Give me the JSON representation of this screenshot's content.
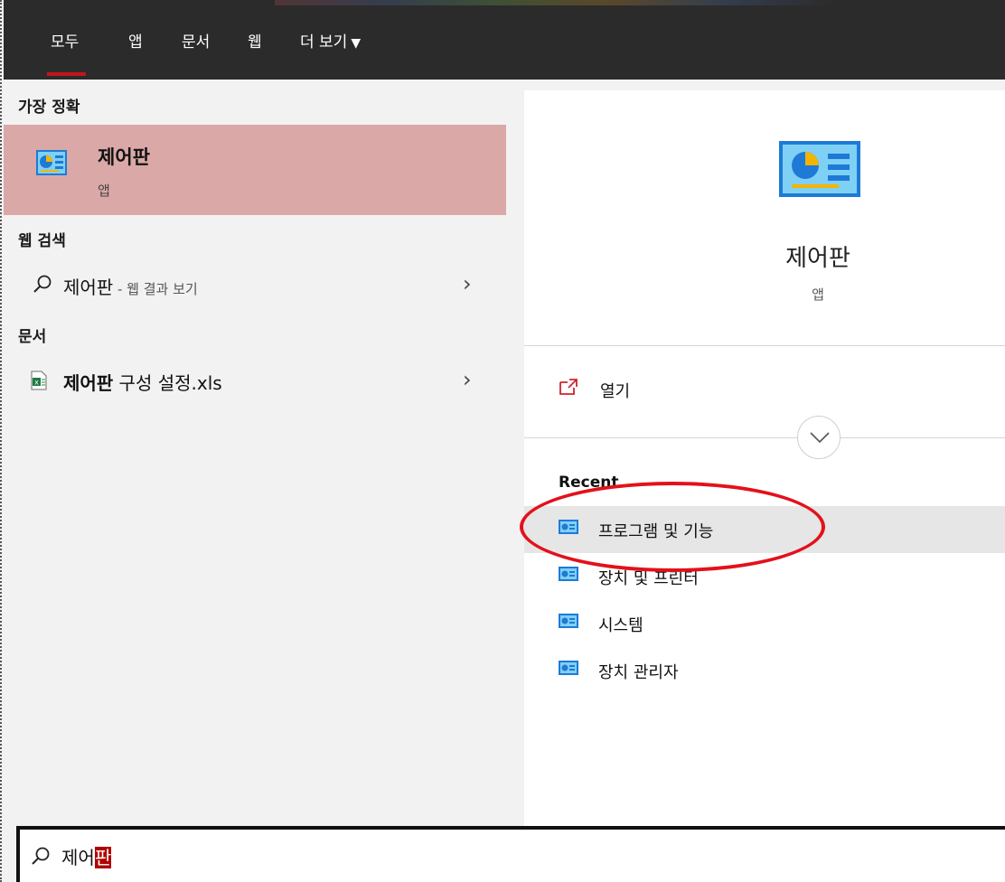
{
  "tabs": [
    {
      "label": "모두",
      "active": true
    },
    {
      "label": "앱"
    },
    {
      "label": "문서"
    },
    {
      "label": "웹"
    },
    {
      "label": "더 보기"
    }
  ],
  "left": {
    "best_match_heading": "가장 정확",
    "best_match": {
      "title": "제어판",
      "subtitle": "앱",
      "icon": "control-panel-icon"
    },
    "web_heading": "웹 검색",
    "web_result": {
      "query": "제어판",
      "suffix": " - 웹 결과 보기"
    },
    "docs_heading": "문서",
    "doc_result": {
      "bold": "제어판",
      "rest": " 구성 설정.xls",
      "icon": "excel-file-icon"
    }
  },
  "right": {
    "app_title": "제어판",
    "app_subtitle": "앱",
    "open_label": "열기",
    "recent_heading": "Recent",
    "recent_items": [
      {
        "label": "프로그램 및 기능",
        "highlighted": true
      },
      {
        "label": "장치 및 프린터"
      },
      {
        "label": "시스템"
      },
      {
        "label": "장치 관리자"
      }
    ]
  },
  "search": {
    "query_prefix": "제어",
    "query_highlight": "판"
  },
  "colors": {
    "accent": "#c0161b",
    "selected_bg": "#dba8a8",
    "annotation": "#e3111b"
  }
}
